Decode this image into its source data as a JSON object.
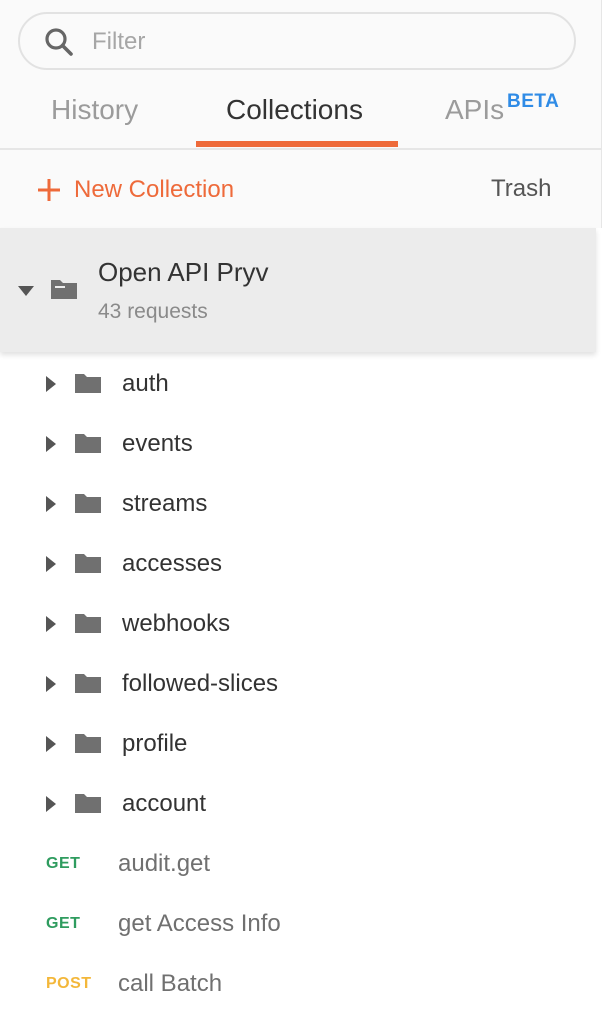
{
  "search": {
    "placeholder": "Filter",
    "value": ""
  },
  "tabs": [
    {
      "label": "History",
      "active": false
    },
    {
      "label": "Collections",
      "active": true
    },
    {
      "label": "APIs",
      "badge": "BETA",
      "active": false
    }
  ],
  "actions": {
    "new_collection": "New Collection",
    "trash": "Trash"
  },
  "collection": {
    "name": "Open API Pryv",
    "count_text": "43 requests",
    "expanded": true
  },
  "folders": [
    {
      "label": "auth"
    },
    {
      "label": "events"
    },
    {
      "label": "streams"
    },
    {
      "label": "accesses"
    },
    {
      "label": "webhooks"
    },
    {
      "label": "followed-slices"
    },
    {
      "label": "profile"
    },
    {
      "label": "account"
    }
  ],
  "requests": [
    {
      "method": "GET",
      "label": "audit.get"
    },
    {
      "method": "GET",
      "label": "get Access Info"
    },
    {
      "method": "POST",
      "label": "call Batch"
    }
  ],
  "colors": {
    "accent": "#ee6a3a",
    "beta": "#2f8be6",
    "get": "#2f9c5f",
    "post": "#f3b73a"
  }
}
